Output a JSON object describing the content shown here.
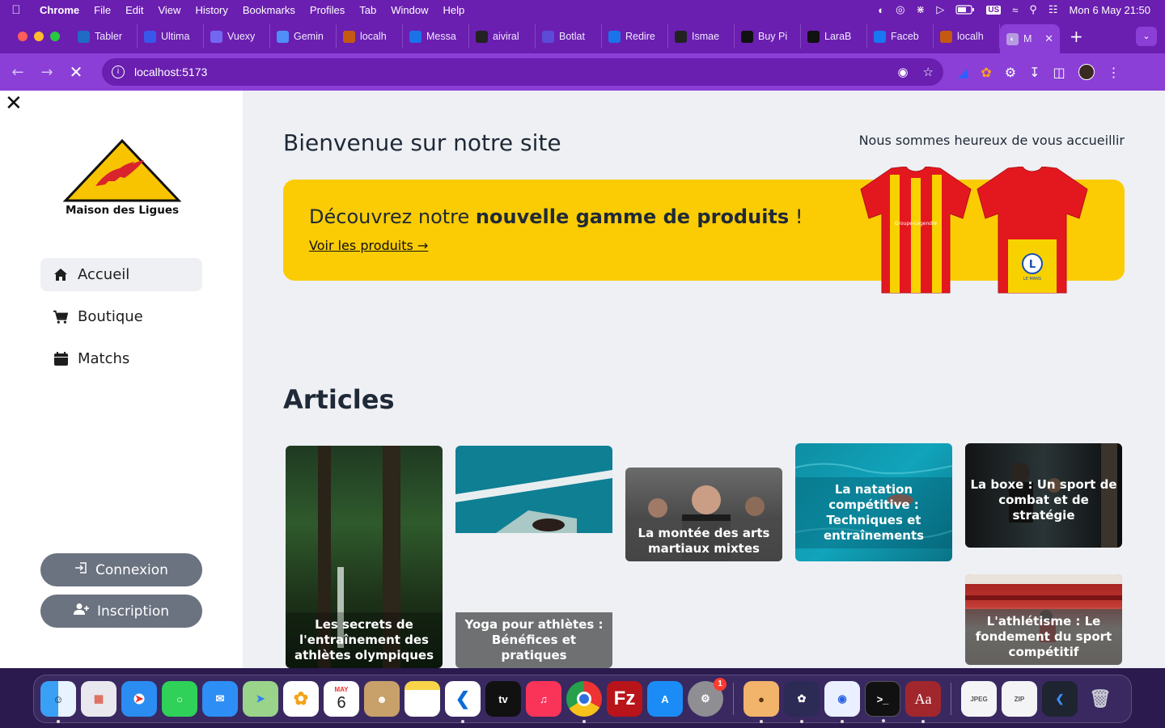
{
  "menubar": {
    "app": "Chrome",
    "items": [
      "File",
      "Edit",
      "View",
      "History",
      "Bookmarks",
      "Profiles",
      "Tab",
      "Window",
      "Help"
    ],
    "input_source": "US",
    "clock": "Mon 6 May  21:50"
  },
  "tabs": [
    {
      "label": "Tabler",
      "color": "#206bc4"
    },
    {
      "label": "Ultima",
      "color": "#3858e9"
    },
    {
      "label": "Vuexy",
      "color": "#7367f0"
    },
    {
      "label": "Gemin",
      "color": "#4f8ff7"
    },
    {
      "label": "localh",
      "color": "#c45a12"
    },
    {
      "label": "Messa",
      "color": "#1a73e8"
    },
    {
      "label": "aiviral",
      "color": "#222222"
    },
    {
      "label": "Botlat",
      "color": "#5c4bd6"
    },
    {
      "label": "Redire",
      "color": "#1a73e8"
    },
    {
      "label": "Ismae",
      "color": "#222222"
    },
    {
      "label": "Buy Pi",
      "color": "#111111"
    },
    {
      "label": "LaraB",
      "color": "#111111"
    },
    {
      "label": "Faceb",
      "color": "#1877f2"
    },
    {
      "label": "localh",
      "color": "#c45a12"
    }
  ],
  "active_tab": {
    "label": "M"
  },
  "address_bar": {
    "url": "localhost:5173"
  },
  "site": {
    "brand": "Maison des Ligues",
    "nav": [
      {
        "label": "Accueil",
        "icon": "home-icon",
        "active": true
      },
      {
        "label": "Boutique",
        "icon": "cart-icon",
        "active": false
      },
      {
        "label": "Matchs",
        "icon": "calendar-icon",
        "active": false
      }
    ],
    "auth": {
      "login": "Connexion",
      "register": "Inscription"
    },
    "welcome": "Bienvenue sur notre site",
    "greeting": "Nous sommes heureux de vous accueillir",
    "banner": {
      "title_prefix": "Découvrez notre ",
      "title_bold": "nouvelle gamme de produits",
      "title_suffix": " !",
      "link": "Voir les produits →",
      "jersey_sponsor": "Groupe-Legendre",
      "jersey_badge": "LE MANS"
    },
    "articles_heading": "Articles",
    "articles": [
      {
        "title": "Les secrets de l'entraînement des athlètes olympiques"
      },
      {
        "title": "Yoga pour athlètes : Bénéfices et pratiques"
      },
      {
        "title": "La montée des arts martiaux mixtes"
      },
      {
        "title": "La natation compétitive : Techniques et entraînements"
      },
      {
        "title": "La boxe : Un sport de combat et de stratégie"
      },
      {
        "title": "L'athlétisme : Le fondement du sport compétitif"
      }
    ]
  },
  "dock": {
    "calendar_month": "MAY",
    "calendar_day": "6",
    "settings_badge": "1",
    "apps": [
      "Finder",
      "Launchpad",
      "Safari",
      "Messages",
      "Mail",
      "Maps",
      "Photos",
      "Calendar",
      "Contacts",
      "Notes",
      "VS Code",
      "TV",
      "Music",
      "Chrome",
      "FileZilla",
      "App Store",
      "System Settings",
      "TablePlus",
      "ChatGPT",
      "Proxyman",
      "Terminal",
      "Dictionary"
    ]
  },
  "colors": {
    "accent": "#6a1fb0",
    "banner": "#fbcc04",
    "button": "#6b7280"
  }
}
